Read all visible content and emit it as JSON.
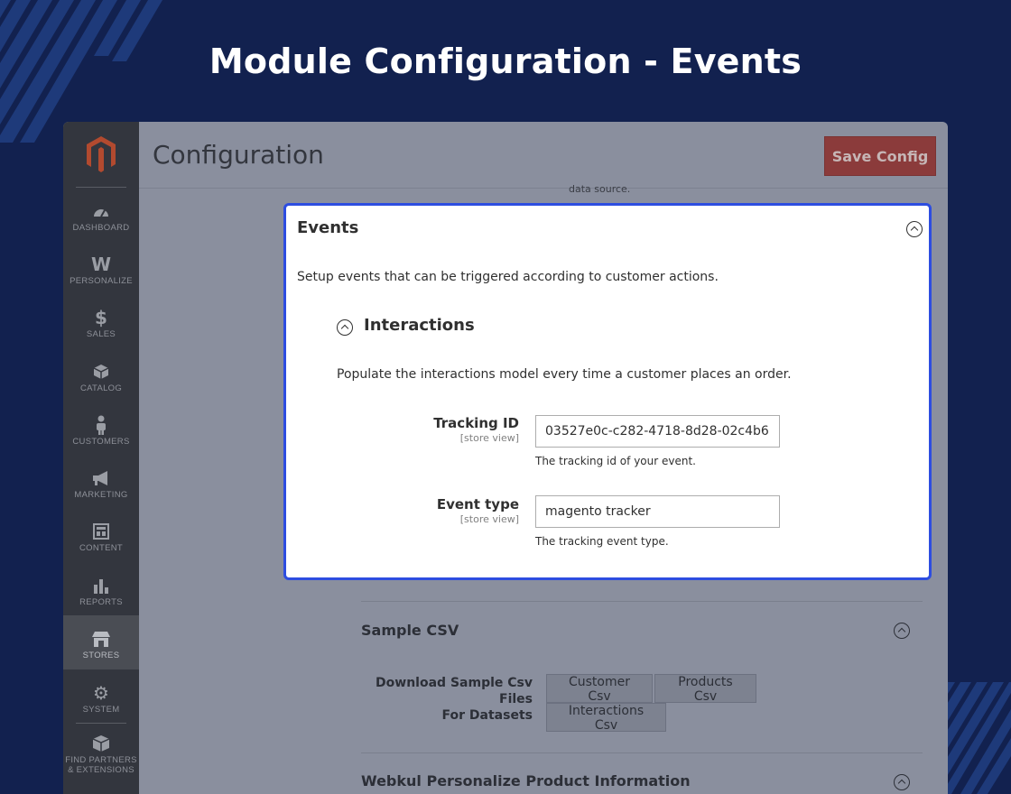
{
  "hero": {
    "title": "Module Configuration - Events"
  },
  "colors": {
    "background": "#12214f",
    "modal_border": "#2d4de0",
    "save_button": "#8b3b3b",
    "sidebar": "#33363e"
  },
  "sidebar": {
    "logo": "magento-logo",
    "items": [
      {
        "label": "DASHBOARD",
        "icon": "speedometer-icon"
      },
      {
        "label": "PERSONALIZE",
        "icon": "w-logo-icon"
      },
      {
        "label": "SALES",
        "icon": "dollar-icon"
      },
      {
        "label": "CATALOG",
        "icon": "box-icon"
      },
      {
        "label": "CUSTOMERS",
        "icon": "person-icon"
      },
      {
        "label": "MARKETING",
        "icon": "megaphone-icon"
      },
      {
        "label": "CONTENT",
        "icon": "layout-icon"
      },
      {
        "label": "REPORTS",
        "icon": "bar-chart-icon"
      },
      {
        "label": "STORES",
        "icon": "storefront-icon",
        "active": true
      },
      {
        "label": "SYSTEM",
        "icon": "gear-icon"
      },
      {
        "label": "FIND PARTNERS\n& EXTENSIONS",
        "line1": "FIND PARTNERS",
        "line2": "& EXTENSIONS",
        "icon": "boxes-icon"
      }
    ]
  },
  "header": {
    "title": "Configuration",
    "save_label": "Save Config",
    "faded_note": "data source."
  },
  "events_panel": {
    "title": "Events",
    "description": "Setup events that can be triggered according to customer actions.",
    "interactions": {
      "title": "Interactions",
      "description": "Populate the interactions model every time a customer places an order.",
      "fields": [
        {
          "label": "Tracking ID",
          "scope": "[store view]",
          "value": "03527e0c-c282-4718-8d28-02c4b6",
          "note": "The tracking id of your event."
        },
        {
          "label": "Event type",
          "scope": "[store view]",
          "value": "magento tracker",
          "note": "The tracking event type."
        }
      ]
    }
  },
  "sample_csv": {
    "title": "Sample CSV",
    "label_line1": "Download Sample Csv Files",
    "label_line2": "For Datasets",
    "buttons": [
      "Customer Csv",
      "Products Csv",
      "Interactions Csv"
    ]
  },
  "webkul_section": {
    "title": "Webkul Personalize Product Information"
  }
}
